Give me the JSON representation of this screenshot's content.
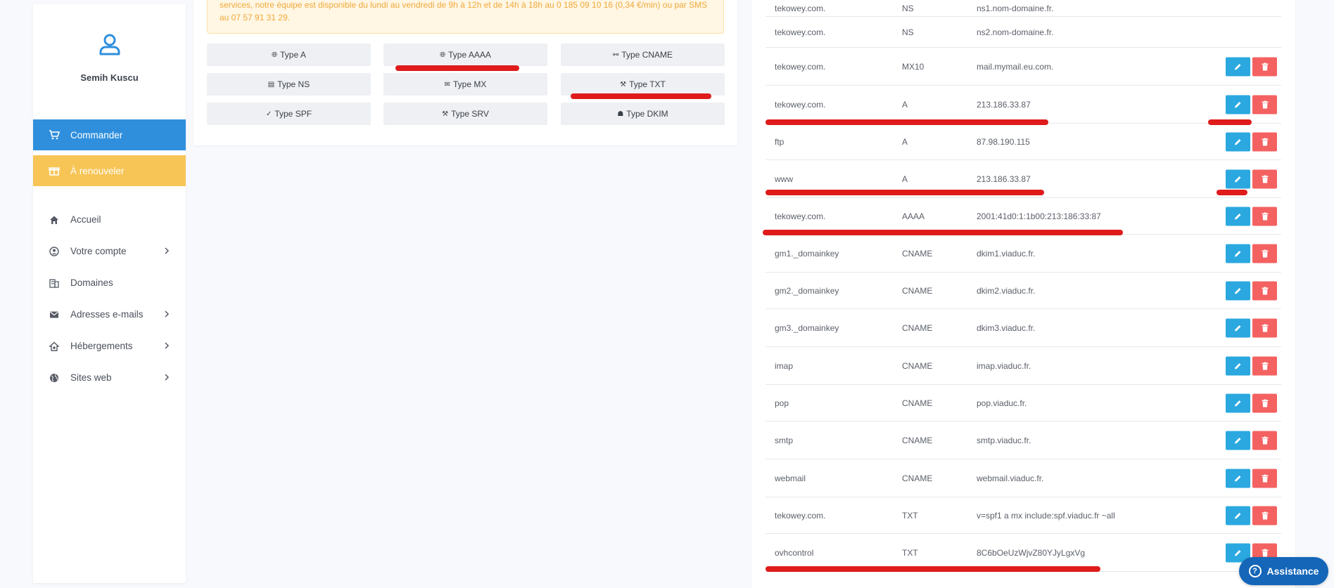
{
  "sidebar": {
    "user_name": "Semih Kuscu",
    "commander_label": "Commander",
    "renew_label": "À renouveler",
    "nav": [
      {
        "label": "Accueil"
      },
      {
        "label": "Votre compte"
      },
      {
        "label": "Domaines"
      },
      {
        "label": "Adresses e-mails"
      },
      {
        "label": "Hébergements"
      },
      {
        "label": "Sites web"
      }
    ]
  },
  "alert": {
    "text": "services, notre équipe est disponible du lundi au vendredi de 9h à 12h et de 14h à 18h au 0 185 09 10 16 (0,34 €/min) ou par SMS au 07 57 91 31 29."
  },
  "record_types": [
    {
      "label": "Type A",
      "icon": "globe-icon"
    },
    {
      "label": "Type AAAA",
      "icon": "globe-icon"
    },
    {
      "label": "Type CNAME",
      "icon": "link-icon"
    },
    {
      "label": "Type NS",
      "icon": "server-icon"
    },
    {
      "label": "Type MX",
      "icon": "envelope-icon"
    },
    {
      "label": "Type TXT",
      "icon": "tools-icon"
    },
    {
      "label": "Type SPF",
      "icon": "check-icon"
    },
    {
      "label": "Type SRV",
      "icon": "tools-icon"
    },
    {
      "label": "Type DKIM",
      "icon": "user-secret-icon"
    }
  ],
  "dns_records": [
    {
      "name": "tekowey.com.",
      "type": "NS",
      "value": "ns1.nom-domaine.fr.",
      "actions": false
    },
    {
      "name": "tekowey.com.",
      "type": "NS",
      "value": "ns2.nom-domaine.fr.",
      "actions": false
    },
    {
      "name": "tekowey.com.",
      "type": "MX10",
      "value": "mail.mymail.eu.com.",
      "actions": true
    },
    {
      "name": "tekowey.com.",
      "type": "A",
      "value": "213.186.33.87",
      "actions": true
    },
    {
      "name": "ftp",
      "type": "A",
      "value": "87.98.190.115",
      "actions": true
    },
    {
      "name": "www",
      "type": "A",
      "value": "213.186.33.87",
      "actions": true
    },
    {
      "name": "tekowey.com.",
      "type": "AAAA",
      "value": "2001:41d0:1:1b00:213:186:33:87",
      "actions": true
    },
    {
      "name": "gm1._domainkey",
      "type": "CNAME",
      "value": "dkim1.viaduc.fr.",
      "actions": true
    },
    {
      "name": "gm2._domainkey",
      "type": "CNAME",
      "value": "dkim2.viaduc.fr.",
      "actions": true
    },
    {
      "name": "gm3._domainkey",
      "type": "CNAME",
      "value": "dkim3.viaduc.fr.",
      "actions": true
    },
    {
      "name": "imap",
      "type": "CNAME",
      "value": "imap.viaduc.fr.",
      "actions": true
    },
    {
      "name": "pop",
      "type": "CNAME",
      "value": "pop.viaduc.fr.",
      "actions": true
    },
    {
      "name": "smtp",
      "type": "CNAME",
      "value": "smtp.viaduc.fr.",
      "actions": true
    },
    {
      "name": "webmail",
      "type": "CNAME",
      "value": "webmail.viaduc.fr.",
      "actions": true
    },
    {
      "name": "tekowey.com.",
      "type": "TXT",
      "value": "v=spf1 a mx include:spf.viaduc.fr ~all",
      "actions": true
    },
    {
      "name": "ovhcontrol",
      "type": "TXT",
      "value": "8C6bOeUzWjvZ80YJyLgxVg",
      "actions": true
    }
  ],
  "assistance": {
    "label": "Assistance"
  },
  "colors": {
    "primary": "#2f8fdd",
    "warning": "#f7c556",
    "edit": "#2aa8df",
    "delete": "#f46161",
    "annotation": "#df1b1b"
  }
}
